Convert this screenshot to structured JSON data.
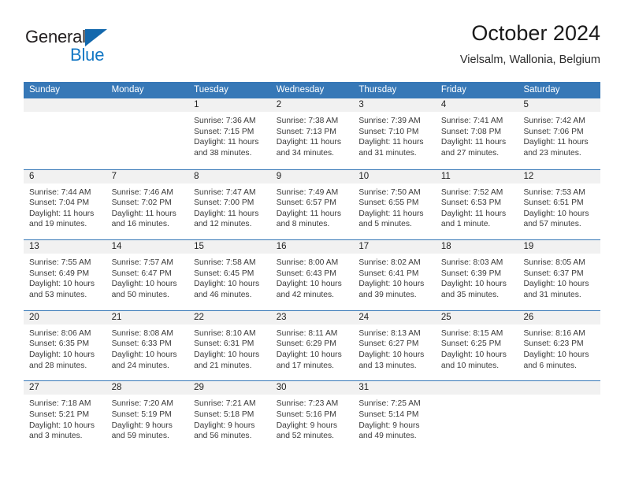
{
  "brand": {
    "name_top": "General",
    "name_bottom": "Blue",
    "accent_color": "#1368ad"
  },
  "header": {
    "title": "October 2024",
    "location": "Vielsalm, Wallonia, Belgium"
  },
  "calendar": {
    "header_color": "#3778b7",
    "day_band_color": "#f1f1f1",
    "weekdays": [
      "Sunday",
      "Monday",
      "Tuesday",
      "Wednesday",
      "Thursday",
      "Friday",
      "Saturday"
    ],
    "weeks": [
      [
        {
          "day": "",
          "sunrise": "",
          "sunset": "",
          "daylight": "",
          "empty": true
        },
        {
          "day": "",
          "sunrise": "",
          "sunset": "",
          "daylight": "",
          "empty": true
        },
        {
          "day": "1",
          "sunrise": "Sunrise: 7:36 AM",
          "sunset": "Sunset: 7:15 PM",
          "daylight": "Daylight: 11 hours and 38 minutes."
        },
        {
          "day": "2",
          "sunrise": "Sunrise: 7:38 AM",
          "sunset": "Sunset: 7:13 PM",
          "daylight": "Daylight: 11 hours and 34 minutes."
        },
        {
          "day": "3",
          "sunrise": "Sunrise: 7:39 AM",
          "sunset": "Sunset: 7:10 PM",
          "daylight": "Daylight: 11 hours and 31 minutes."
        },
        {
          "day": "4",
          "sunrise": "Sunrise: 7:41 AM",
          "sunset": "Sunset: 7:08 PM",
          "daylight": "Daylight: 11 hours and 27 minutes."
        },
        {
          "day": "5",
          "sunrise": "Sunrise: 7:42 AM",
          "sunset": "Sunset: 7:06 PM",
          "daylight": "Daylight: 11 hours and 23 minutes."
        }
      ],
      [
        {
          "day": "6",
          "sunrise": "Sunrise: 7:44 AM",
          "sunset": "Sunset: 7:04 PM",
          "daylight": "Daylight: 11 hours and 19 minutes."
        },
        {
          "day": "7",
          "sunrise": "Sunrise: 7:46 AM",
          "sunset": "Sunset: 7:02 PM",
          "daylight": "Daylight: 11 hours and 16 minutes."
        },
        {
          "day": "8",
          "sunrise": "Sunrise: 7:47 AM",
          "sunset": "Sunset: 7:00 PM",
          "daylight": "Daylight: 11 hours and 12 minutes."
        },
        {
          "day": "9",
          "sunrise": "Sunrise: 7:49 AM",
          "sunset": "Sunset: 6:57 PM",
          "daylight": "Daylight: 11 hours and 8 minutes."
        },
        {
          "day": "10",
          "sunrise": "Sunrise: 7:50 AM",
          "sunset": "Sunset: 6:55 PM",
          "daylight": "Daylight: 11 hours and 5 minutes."
        },
        {
          "day": "11",
          "sunrise": "Sunrise: 7:52 AM",
          "sunset": "Sunset: 6:53 PM",
          "daylight": "Daylight: 11 hours and 1 minute."
        },
        {
          "day": "12",
          "sunrise": "Sunrise: 7:53 AM",
          "sunset": "Sunset: 6:51 PM",
          "daylight": "Daylight: 10 hours and 57 minutes."
        }
      ],
      [
        {
          "day": "13",
          "sunrise": "Sunrise: 7:55 AM",
          "sunset": "Sunset: 6:49 PM",
          "daylight": "Daylight: 10 hours and 53 minutes."
        },
        {
          "day": "14",
          "sunrise": "Sunrise: 7:57 AM",
          "sunset": "Sunset: 6:47 PM",
          "daylight": "Daylight: 10 hours and 50 minutes."
        },
        {
          "day": "15",
          "sunrise": "Sunrise: 7:58 AM",
          "sunset": "Sunset: 6:45 PM",
          "daylight": "Daylight: 10 hours and 46 minutes."
        },
        {
          "day": "16",
          "sunrise": "Sunrise: 8:00 AM",
          "sunset": "Sunset: 6:43 PM",
          "daylight": "Daylight: 10 hours and 42 minutes."
        },
        {
          "day": "17",
          "sunrise": "Sunrise: 8:02 AM",
          "sunset": "Sunset: 6:41 PM",
          "daylight": "Daylight: 10 hours and 39 minutes."
        },
        {
          "day": "18",
          "sunrise": "Sunrise: 8:03 AM",
          "sunset": "Sunset: 6:39 PM",
          "daylight": "Daylight: 10 hours and 35 minutes."
        },
        {
          "day": "19",
          "sunrise": "Sunrise: 8:05 AM",
          "sunset": "Sunset: 6:37 PM",
          "daylight": "Daylight: 10 hours and 31 minutes."
        }
      ],
      [
        {
          "day": "20",
          "sunrise": "Sunrise: 8:06 AM",
          "sunset": "Sunset: 6:35 PM",
          "daylight": "Daylight: 10 hours and 28 minutes."
        },
        {
          "day": "21",
          "sunrise": "Sunrise: 8:08 AM",
          "sunset": "Sunset: 6:33 PM",
          "daylight": "Daylight: 10 hours and 24 minutes."
        },
        {
          "day": "22",
          "sunrise": "Sunrise: 8:10 AM",
          "sunset": "Sunset: 6:31 PM",
          "daylight": "Daylight: 10 hours and 21 minutes."
        },
        {
          "day": "23",
          "sunrise": "Sunrise: 8:11 AM",
          "sunset": "Sunset: 6:29 PM",
          "daylight": "Daylight: 10 hours and 17 minutes."
        },
        {
          "day": "24",
          "sunrise": "Sunrise: 8:13 AM",
          "sunset": "Sunset: 6:27 PM",
          "daylight": "Daylight: 10 hours and 13 minutes."
        },
        {
          "day": "25",
          "sunrise": "Sunrise: 8:15 AM",
          "sunset": "Sunset: 6:25 PM",
          "daylight": "Daylight: 10 hours and 10 minutes."
        },
        {
          "day": "26",
          "sunrise": "Sunrise: 8:16 AM",
          "sunset": "Sunset: 6:23 PM",
          "daylight": "Daylight: 10 hours and 6 minutes."
        }
      ],
      [
        {
          "day": "27",
          "sunrise": "Sunrise: 7:18 AM",
          "sunset": "Sunset: 5:21 PM",
          "daylight": "Daylight: 10 hours and 3 minutes."
        },
        {
          "day": "28",
          "sunrise": "Sunrise: 7:20 AM",
          "sunset": "Sunset: 5:19 PM",
          "daylight": "Daylight: 9 hours and 59 minutes."
        },
        {
          "day": "29",
          "sunrise": "Sunrise: 7:21 AM",
          "sunset": "Sunset: 5:18 PM",
          "daylight": "Daylight: 9 hours and 56 minutes."
        },
        {
          "day": "30",
          "sunrise": "Sunrise: 7:23 AM",
          "sunset": "Sunset: 5:16 PM",
          "daylight": "Daylight: 9 hours and 52 minutes."
        },
        {
          "day": "31",
          "sunrise": "Sunrise: 7:25 AM",
          "sunset": "Sunset: 5:14 PM",
          "daylight": "Daylight: 9 hours and 49 minutes."
        },
        {
          "day": "",
          "sunrise": "",
          "sunset": "",
          "daylight": "",
          "empty": true
        },
        {
          "day": "",
          "sunrise": "",
          "sunset": "",
          "daylight": "",
          "empty": true
        }
      ]
    ]
  }
}
